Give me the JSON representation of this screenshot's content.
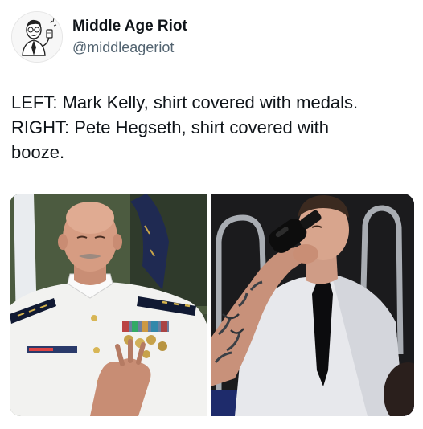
{
  "author": {
    "display_name": "Middle Age Riot",
    "handle": "@middleageriot"
  },
  "post": {
    "text_lines": [
      "LEFT: Mark Kelly, shirt covered with medals.",
      "RIGHT: Pete Hegseth, shirt covered with",
      "booze."
    ]
  },
  "media": {
    "count": 2
  },
  "icons": {
    "avatar": "cartoon-man-drinking-avatar"
  }
}
